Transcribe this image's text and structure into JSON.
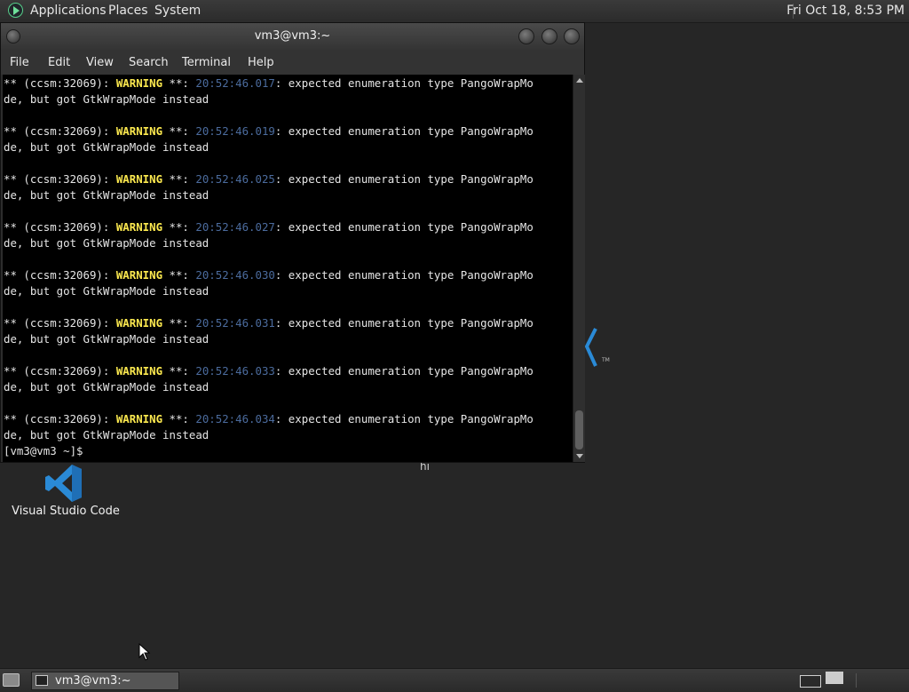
{
  "top_panel": {
    "menus": [
      "Applications",
      "Places",
      "System"
    ],
    "clock": "Fri Oct 18,  8:53 PM"
  },
  "window": {
    "title": "vm3@vm3:~",
    "menus": [
      "File",
      "Edit",
      "View",
      "Search",
      "Terminal",
      "Help"
    ]
  },
  "terminal": {
    "entries": [
      {
        "prefix": "** (ccsm:32069): ",
        "level": "WARNING",
        "sep": " **: ",
        "time": "20:52:46.017",
        "msg1": ": expected enumeration type PangoWrapMo",
        "msg2": "de, but got GtkWrapMode instead"
      },
      {
        "prefix": "** (ccsm:32069): ",
        "level": "WARNING",
        "sep": " **: ",
        "time": "20:52:46.019",
        "msg1": ": expected enumeration type PangoWrapMo",
        "msg2": "de, but got GtkWrapMode instead"
      },
      {
        "prefix": "** (ccsm:32069): ",
        "level": "WARNING",
        "sep": " **: ",
        "time": "20:52:46.025",
        "msg1": ": expected enumeration type PangoWrapMo",
        "msg2": "de, but got GtkWrapMode instead"
      },
      {
        "prefix": "** (ccsm:32069): ",
        "level": "WARNING",
        "sep": " **: ",
        "time": "20:52:46.027",
        "msg1": ": expected enumeration type PangoWrapMo",
        "msg2": "de, but got GtkWrapMode instead"
      },
      {
        "prefix": "** (ccsm:32069): ",
        "level": "WARNING",
        "sep": " **: ",
        "time": "20:52:46.030",
        "msg1": ": expected enumeration type PangoWrapMo",
        "msg2": "de, but got GtkWrapMode instead"
      },
      {
        "prefix": "** (ccsm:32069): ",
        "level": "WARNING",
        "sep": " **: ",
        "time": "20:52:46.031",
        "msg1": ": expected enumeration type PangoWrapMo",
        "msg2": "de, but got GtkWrapMode instead"
      },
      {
        "prefix": "** (ccsm:32069): ",
        "level": "WARNING",
        "sep": " **: ",
        "time": "20:52:46.033",
        "msg1": ": expected enumeration type PangoWrapMo",
        "msg2": "de, but got GtkWrapMode instead"
      },
      {
        "prefix": "** (ccsm:32069): ",
        "level": "WARNING",
        "sep": " **: ",
        "time": "20:52:46.034",
        "msg1": ": expected enumeration type PangoWrapMo",
        "msg2": "de, but got GtkWrapMode instead"
      }
    ],
    "prompt": "[vm3@vm3 ~]$ "
  },
  "desktop": {
    "vscode_label": "Visual Studio Code",
    "hi_label": "hi",
    "tm": "TM"
  },
  "taskbar": {
    "task_label": "vm3@vm3:~"
  },
  "colors": {
    "warning": "#fce94f",
    "timestamp": "#4b6b9d",
    "vscode_blue": "#2a8ad6"
  },
  "icons": {
    "apps_logo": "applications-logo-icon",
    "vscode": "vscode-icon",
    "terminal": "terminal-icon",
    "cursor": "mouse-pointer-icon"
  }
}
